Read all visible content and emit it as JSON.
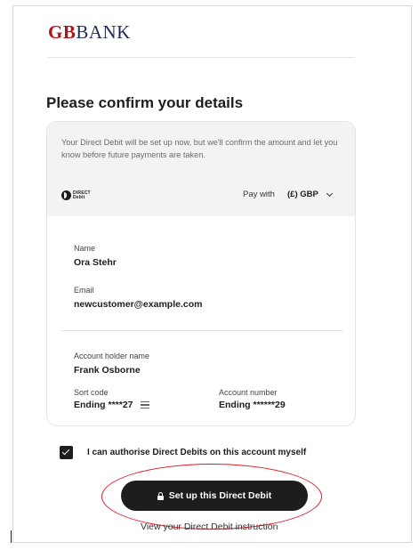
{
  "brand": {
    "gb": "GB",
    "bank": "BANK"
  },
  "page": {
    "title": "Please confirm your details"
  },
  "direct_debit": {
    "notice": "Your Direct Debit will be set up now, but we'll confirm the amount and let you know before future payments are taken.",
    "logo_text_line1": "DIRECT",
    "logo_text_line2": "Debit",
    "pay_with_label": "Pay with",
    "currency": "(£) GBP"
  },
  "customer": {
    "name_label": "Name",
    "name": "Ora Stehr",
    "email_label": "Email",
    "email": "newcustomer@example.com"
  },
  "account": {
    "holder_label": "Account holder name",
    "holder": "Frank Osborne",
    "sort_code_label": "Sort code",
    "sort_code": "Ending ****27",
    "number_label": "Account number",
    "number": "Ending ******29"
  },
  "authorise": {
    "label": "I can authorise Direct Debits on this account myself",
    "checked": true
  },
  "actions": {
    "submit": "Set up this Direct Debit",
    "view_instruction": "View your Direct Debit instruction"
  },
  "colors": {
    "brand_red": "#b5121b",
    "brand_navy": "#1f2a5c",
    "button": "#1d1d1b",
    "annotation": "#e01b24"
  },
  "icons": [
    "direct-debit-logo",
    "chevron-down-icon",
    "bank-stack-icon",
    "checkmark-icon",
    "lock-icon"
  ]
}
